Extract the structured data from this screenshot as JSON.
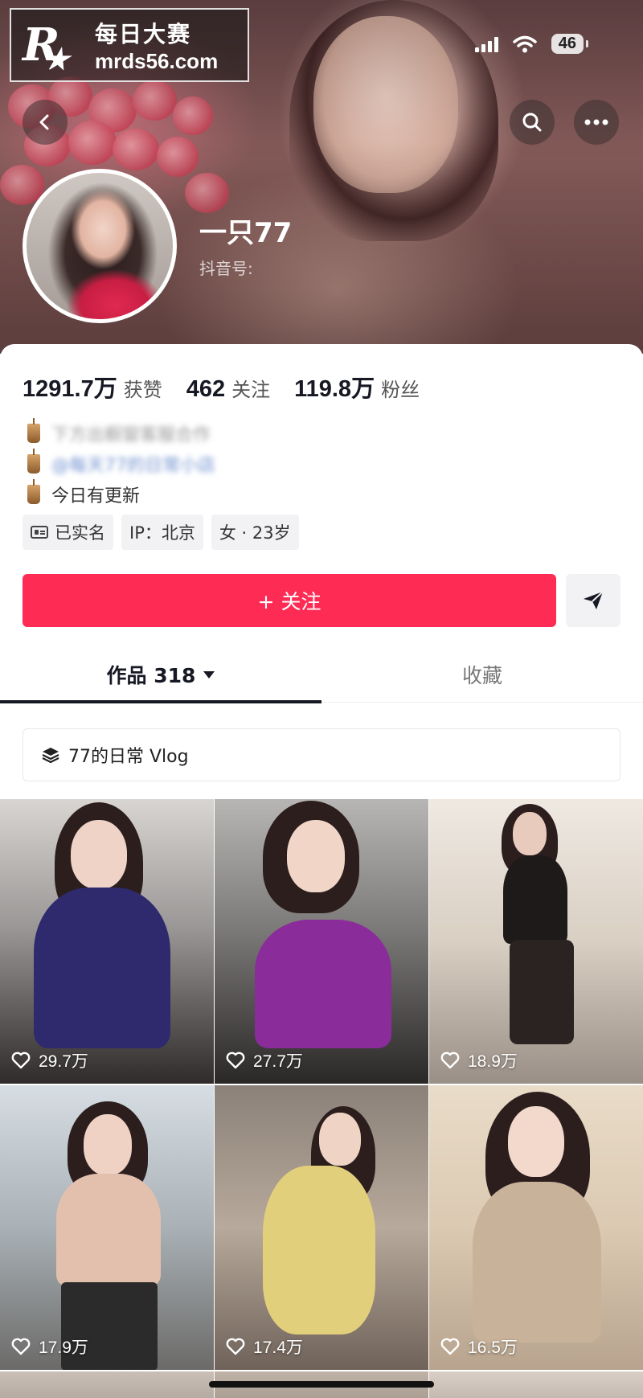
{
  "watermark": {
    "logo": "R",
    "line1": "每日大赛",
    "line2": "mrds56.com"
  },
  "status_bar": {
    "battery": "46"
  },
  "profile": {
    "nickname": "一只77",
    "douyin_id_label": "抖音号:",
    "stats": [
      {
        "value": "1291.7万",
        "label": "获赞"
      },
      {
        "value": "462",
        "label": "关注"
      },
      {
        "value": "119.8万",
        "label": "粉丝"
      }
    ],
    "bio": {
      "line1_blurred": "下方出橱窗客服合作",
      "line2_blurred": "@每天77的日常小店",
      "line3": "今日有更新"
    },
    "tags": [
      "已实名",
      "IP：北京",
      "女 · 23岁"
    ],
    "follow_button": "+ 关注"
  },
  "tabs": {
    "works": "作品 318",
    "favorites": "收藏"
  },
  "collection": {
    "label": "77的日常 Vlog"
  },
  "grid": [
    {
      "likes": "29.7万"
    },
    {
      "likes": "27.7万"
    },
    {
      "likes": "18.9万"
    },
    {
      "likes": "17.9万"
    },
    {
      "likes": "17.4万"
    },
    {
      "likes": "16.5万"
    }
  ],
  "colors": {
    "accent": "#fe2c55",
    "text": "#161823"
  }
}
